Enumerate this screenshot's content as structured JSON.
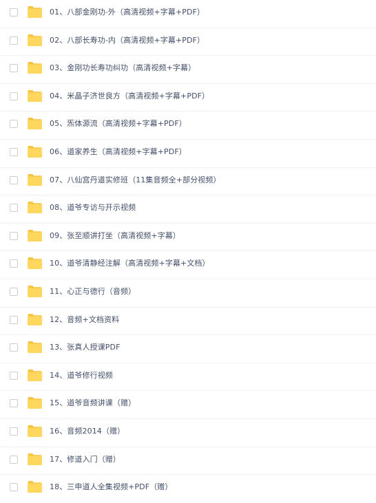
{
  "file_list": {
    "items": [
      {
        "name": "01、八部金刚功-外（高清视频+字幕+PDF）",
        "type": "folder"
      },
      {
        "name": "02、八部长寿功-内（高清视频+字幕+PDF）",
        "type": "folder"
      },
      {
        "name": "03、金刚功长寿功纠功（高清视频+字幕）",
        "type": "folder"
      },
      {
        "name": "04、米晶子济世良方（高清视频+字幕+PDF）",
        "type": "folder"
      },
      {
        "name": "05、炁体源流（高清视频+字幕+PDF）",
        "type": "folder"
      },
      {
        "name": "06、道家养生（高清视频+字幕+PDF）",
        "type": "folder"
      },
      {
        "name": "07、八仙宫丹道实修班（11集音频全+部分视频）",
        "type": "folder"
      },
      {
        "name": "08、道爷专访与开示视频",
        "type": "folder"
      },
      {
        "name": "09、张至顺讲打坐（高清视频+字幕）",
        "type": "folder"
      },
      {
        "name": "10、道爷清静经注解（高清视频+字幕+文档）",
        "type": "folder"
      },
      {
        "name": "11、心正与德行（音频）",
        "type": "folder"
      },
      {
        "name": "12、音频+文档资料",
        "type": "folder"
      },
      {
        "name": "13、张真人授课PDF",
        "type": "folder"
      },
      {
        "name": "14、道爷修行视频",
        "type": "folder"
      },
      {
        "name": "15、道爷音频讲课（赠）",
        "type": "folder"
      },
      {
        "name": "16、音频2014（赠）",
        "type": "folder"
      },
      {
        "name": "17、修道入门（赠）",
        "type": "folder"
      },
      {
        "name": "18、三申道人全集视频+PDF（赠）",
        "type": "folder"
      }
    ]
  },
  "colors": {
    "folder": "#ffd75e",
    "folder_tab": "#f7c440",
    "text": "#424e67",
    "divider": "#f1f2f4",
    "checkbox_border": "#c9ccd1"
  },
  "icons": {
    "folder": "folder-icon",
    "checkbox": "checkbox"
  }
}
